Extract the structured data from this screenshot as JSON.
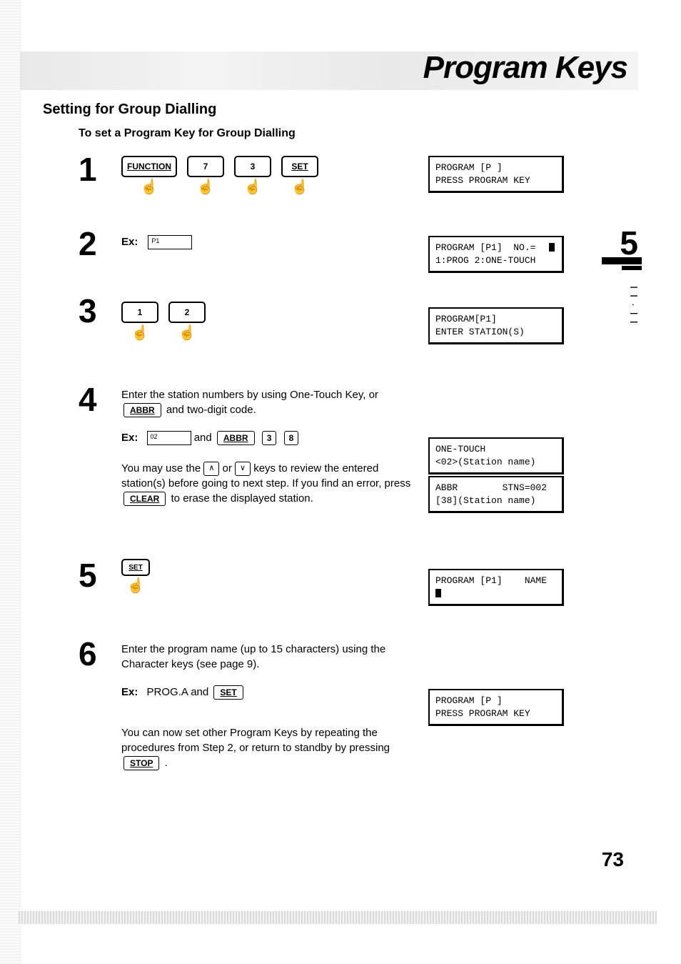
{
  "header": {
    "title": "Program Keys"
  },
  "section_title": "Setting for Group Dialling",
  "sub_title": "To set a Program Key for Group Dialling",
  "tab": {
    "chapter": "5"
  },
  "page_number": "73",
  "steps": {
    "s1": {
      "num": "1",
      "keys": {
        "k1": "FUNCTION",
        "k2": "7",
        "k3": "3",
        "k4": "SET"
      },
      "lcd": "PROGRAM [P ]\nPRESS PROGRAM KEY"
    },
    "s2": {
      "num": "2",
      "ex_label": "Ex:",
      "ex_box": "P1",
      "lcd": "PROGRAM [P1]  NO.=\n1:PROG 2:ONE-TOUCH"
    },
    "s3": {
      "num": "3",
      "keys": {
        "k1": "1",
        "k2": "2"
      },
      "lcd": "PROGRAM[P1]\nENTER STATION(S)"
    },
    "s4": {
      "num": "4",
      "text1a": "Enter the station numbers by using One-Touch Key, or ",
      "abbr_key": "ABBR",
      "text1b": " and two-digit code.",
      "ex_label": "Ex:",
      "ex_box": "02",
      "ex_and": " and ",
      "ex_k1": "ABBR",
      "ex_k2": "3",
      "ex_k3": "8",
      "text2a": "You may use the ",
      "text2b": " or ",
      "text2c": " keys to review the entered station(s) before going to next step. If you find an error, press ",
      "clear_key": "CLEAR",
      "text2d": " to erase the displayed station.",
      "lcd1": "ONE-TOUCH\n<02>(Station name)",
      "lcd2": "ABBR        STNS=002\n[38](Station name)"
    },
    "s5": {
      "num": "5",
      "keys": {
        "k1": "SET"
      },
      "lcd": "PROGRAM [P1]    NAME\n"
    },
    "s6": {
      "num": "6",
      "text1": "Enter the program name (up to 15 characters) using the Character keys (see page 9).",
      "ex_label": "Ex:",
      "ex_text": " PROG.A and ",
      "ex_key": "SET",
      "text2a": "You can now set other Program Keys by repeating the procedures from Step 2, or return to standby by pressing ",
      "stop_key": "STOP",
      "text2b": ".",
      "lcd": "PROGRAM [P ]\nPRESS PROGRAM KEY"
    }
  }
}
